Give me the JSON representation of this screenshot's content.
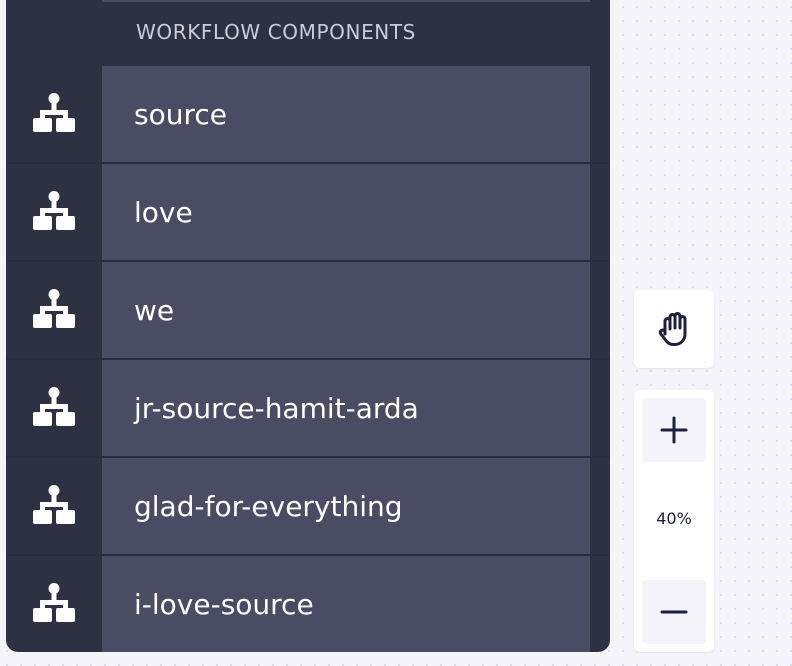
{
  "sidebar": {
    "section_title": "WORKFLOW COMPONENTS",
    "items": [
      {
        "label": "source",
        "icon": "hierarchy-icon"
      },
      {
        "label": "love",
        "icon": "hierarchy-icon"
      },
      {
        "label": "we",
        "icon": "hierarchy-icon"
      },
      {
        "label": "jr-source-hamit-arda",
        "icon": "hierarchy-icon"
      },
      {
        "label": "glad-for-everything",
        "icon": "hierarchy-icon"
      },
      {
        "label": "i-love-source",
        "icon": "hierarchy-icon"
      }
    ]
  },
  "canvas_controls": {
    "pan_icon": "hand-icon",
    "zoom_in_icon": "plus-icon",
    "zoom_out_icon": "minus-icon",
    "zoom_level": "40%"
  },
  "colors": {
    "panel_background": "#2d3142",
    "item_background": "#494c63",
    "section_title": "#c9cbe0",
    "item_text": "#ffffff",
    "canvas_background": "#f4f4fa",
    "control_icon": "#1d1f3f"
  }
}
